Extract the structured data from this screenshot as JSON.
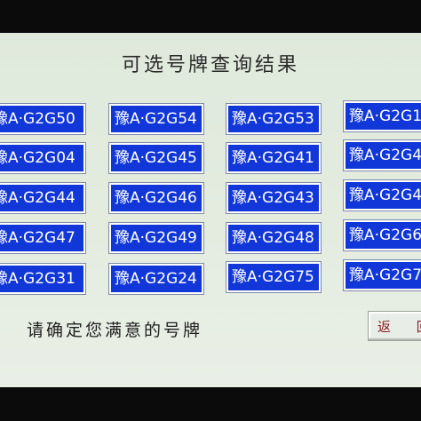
{
  "screen": {
    "title": "可选号牌查询结果",
    "prompt": "请确定您满意的号牌",
    "back_button": "返 回"
  },
  "plates": [
    [
      "豫A·G2G50",
      "豫A·G2G54",
      "豫A·G2G53",
      "豫A·G2G1"
    ],
    [
      "豫A·G2G04",
      "豫A·G2G45",
      "豫A·G2G41",
      "豫A·G2G4"
    ],
    [
      "豫A·G2G44",
      "豫A·G2G46",
      "豫A·G2G43",
      "豫A·G2G4"
    ],
    [
      "豫A·G2G47",
      "豫A·G2G49",
      "豫A·G2G48",
      "豫A·G2G6"
    ],
    [
      "豫A·G2G31",
      "豫A·G2G24",
      "豫A·G2G75",
      "豫A·G2G7"
    ]
  ],
  "colors": {
    "plate_bg": "#1237d8",
    "screen_bg": "#e2ebde"
  }
}
